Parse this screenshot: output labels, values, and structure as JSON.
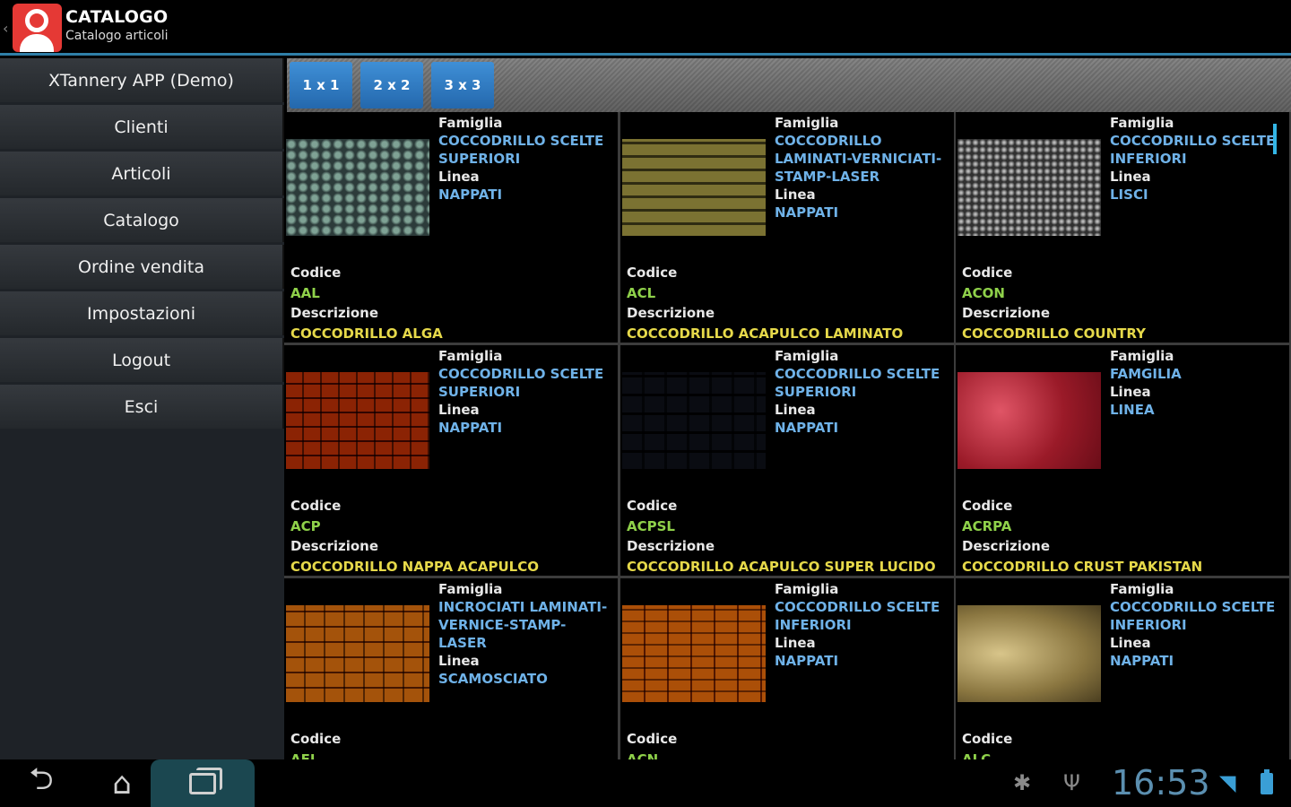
{
  "app": {
    "title": "CATALOGO",
    "subtitle": "Catalogo articoli",
    "accent_color": "#2f7fa8",
    "logo_color": "#e53935"
  },
  "sidebar": {
    "items": [
      {
        "label": "XTannery APP (Demo)"
      },
      {
        "label": "Clienti"
      },
      {
        "label": "Articoli"
      },
      {
        "label": "Catalogo"
      },
      {
        "label": "Ordine vendita"
      },
      {
        "label": "Impostazioni"
      },
      {
        "label": "Logout"
      },
      {
        "label": "Esci"
      }
    ]
  },
  "toolbar": {
    "layouts": [
      {
        "label": "1 x 1"
      },
      {
        "label": "2 x 2"
      },
      {
        "label": "3 x 3"
      }
    ]
  },
  "labels": {
    "famiglia": "Famiglia",
    "linea": "Linea",
    "codice": "Codice",
    "descrizione": "Descrizione"
  },
  "products": [
    {
      "famiglia": "COCCODRILLO SCELTE SUPERIORI",
      "linea": "NAPPATI",
      "codice": "AAL",
      "descrizione": "COCCODRILLO ALGA",
      "texture": "alga"
    },
    {
      "famiglia": "COCCODRILLO LAMINATI-VERNICIATI-STAMP-LASER",
      "linea": "NAPPATI",
      "codice": "ACL",
      "descrizione": "COCCODRILLO ACAPULCO LAMINATO",
      "texture": "acl"
    },
    {
      "famiglia": "COCCODRILLO SCELTE INFERIORI",
      "linea": "LISCI",
      "codice": "ACON",
      "descrizione": "COCCODRILLO COUNTRY",
      "texture": "acon"
    },
    {
      "famiglia": "COCCODRILLO SCELTE SUPERIORI",
      "linea": "NAPPATI",
      "codice": "ACP",
      "descrizione": "COCCODRILLO NAPPA ACAPULCO",
      "texture": "acp"
    },
    {
      "famiglia": "COCCODRILLO SCELTE SUPERIORI",
      "linea": "NAPPATI",
      "codice": "ACPSL",
      "descrizione": "COCCODRILLO ACAPULCO SUPER LUCIDO",
      "texture": "acpsl"
    },
    {
      "famiglia": "FAMGILIA",
      "linea": "LINEA",
      "codice": "ACRPA",
      "descrizione": "COCCODRILLO CRUST PAKISTAN",
      "texture": "acrpa"
    },
    {
      "famiglia": "INCROCIATI LAMINATI-VERNICE-STAMP-LASER",
      "linea": "SCAMOSCIATO",
      "codice": "AFL",
      "descrizione": "",
      "texture": "afl"
    },
    {
      "famiglia": "COCCODRILLO SCELTE INFERIORI",
      "linea": "NAPPATI",
      "codice": "ACN",
      "descrizione": "",
      "texture": "acn"
    },
    {
      "famiglia": "COCCODRILLO SCELTE INFERIORI",
      "linea": "NAPPATI",
      "codice": "ALC",
      "descrizione": "",
      "texture": "alc"
    }
  ],
  "statusbar": {
    "time": "16:53",
    "icons": [
      "back-icon",
      "home-icon",
      "recent-apps-icon",
      "android-debug-icon",
      "usb-icon",
      "wifi-icon",
      "battery-icon"
    ]
  }
}
